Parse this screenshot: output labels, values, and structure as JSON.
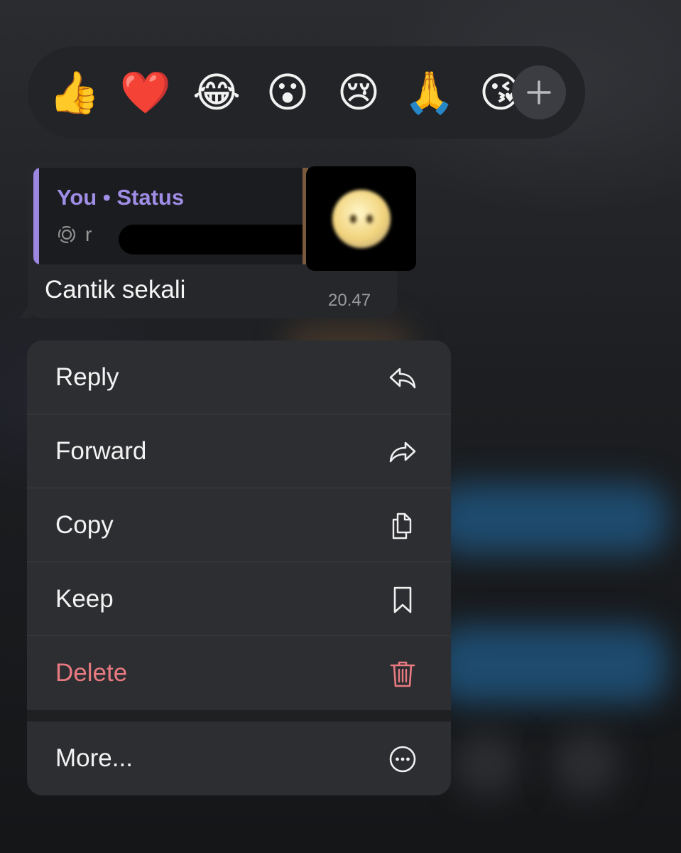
{
  "reactions": {
    "emojis": [
      "👍",
      "❤️",
      "😂",
      "😮",
      "😢",
      "🙏",
      "😘"
    ],
    "more_label": "+"
  },
  "message": {
    "quote": {
      "author": "You • Status",
      "snippet_prefix": "r"
    },
    "text": "Cantik sekali",
    "time": "20.47"
  },
  "menu": {
    "items": [
      {
        "label": "Reply",
        "icon": "reply-icon"
      },
      {
        "label": "Forward",
        "icon": "forward-icon"
      },
      {
        "label": "Copy",
        "icon": "copy-icon"
      },
      {
        "label": "Keep",
        "icon": "bookmark-icon"
      },
      {
        "label": "Delete",
        "icon": "trash-icon"
      },
      {
        "label": "More...",
        "icon": "more-icon"
      }
    ]
  },
  "colors": {
    "accent": "#a08de6",
    "danger": "#e97a82",
    "menu_bg": "#2d2e31"
  }
}
